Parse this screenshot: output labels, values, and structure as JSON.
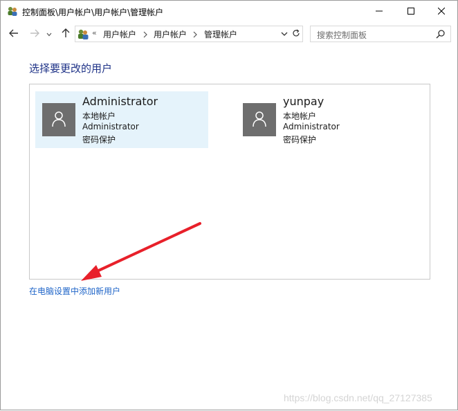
{
  "window": {
    "title": "控制面板\\用户帐户\\用户帐户\\管理帐户",
    "minimize_icon": "minimize-icon",
    "maximize_icon": "maximize-icon",
    "close_icon": "close-icon"
  },
  "nav": {
    "overflow": "«",
    "breadcrumbs": [
      "用户帐户",
      "用户帐户",
      "管理帐户"
    ],
    "search_placeholder": "搜索控制面板"
  },
  "content": {
    "heading": "选择要更改的用户",
    "accounts": [
      {
        "name": "Administrator",
        "type": "本地帐户",
        "group": "Administrator",
        "protection": "密码保护",
        "selected": true
      },
      {
        "name": "yunpay",
        "type": "本地帐户",
        "group": "Administrator",
        "protection": "密码保护",
        "selected": false
      }
    ],
    "add_user_link": "在电脑设置中添加新用户"
  },
  "annotation": {
    "arrow_color": "#e8202a"
  },
  "watermark": "https://blog.csdn.net/qq_27127385",
  "colors": {
    "heading": "#1e3287",
    "link": "#1e64c8",
    "selection": "#e5f3fb",
    "avatar": "#6e6e6e"
  }
}
